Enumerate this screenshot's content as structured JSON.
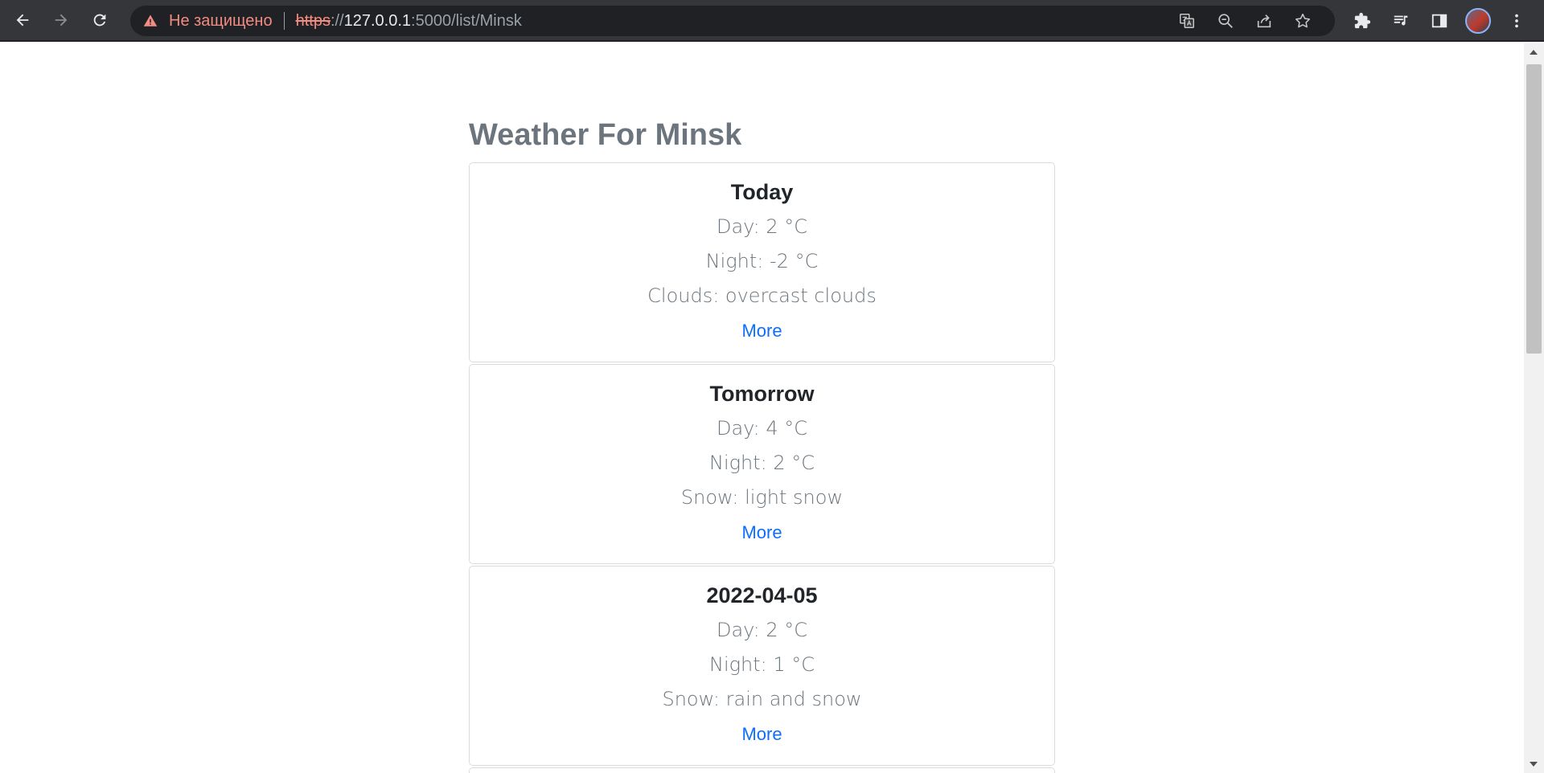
{
  "browser": {
    "insecure_label": "Не защищено",
    "url_scheme": "https",
    "url_sep": "://",
    "url_host": "127.0.0.1",
    "url_path": ":5000/list/Minsk",
    "icons": [
      "back-icon",
      "forward-icon",
      "reload-icon",
      "warning-icon",
      "translate-icon",
      "zoom-out-icon",
      "share-icon",
      "star-icon",
      "extensions-icon",
      "media-icon",
      "side-panel-icon",
      "avatar",
      "menu-icon"
    ]
  },
  "page": {
    "title": "Weather For Minsk",
    "cards": [
      {
        "title": "Today",
        "day": "Day: 2 °C",
        "night": "Night: -2 °C",
        "condition": "Clouds: overcast clouds",
        "link": "More"
      },
      {
        "title": "Tomorrow",
        "day": "Day: 4 °C",
        "night": "Night: 2 °C",
        "condition": "Snow: light snow",
        "link": "More"
      },
      {
        "title": "2022-04-05",
        "day": "Day: 2 °C",
        "night": "Night: 1 °C",
        "condition": "Snow: rain and snow",
        "link": "More"
      }
    ]
  },
  "colors": {
    "title": "#6c757d",
    "link": "#0d6efd",
    "insecure": "#f28b82"
  }
}
